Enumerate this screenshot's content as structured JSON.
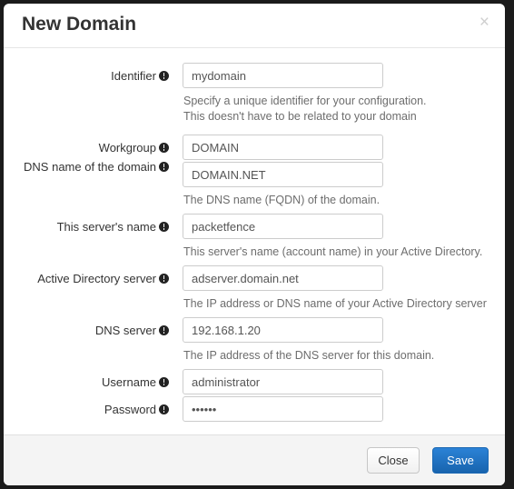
{
  "modal": {
    "title": "New Domain",
    "close_icon": "×",
    "footer": {
      "close_label": "Close",
      "save_label": "Save"
    },
    "accent_color": "#2b82d6",
    "fields": [
      {
        "label": "Identifier",
        "value": "mydomain",
        "help": [
          "Specify a unique identifier for your configuration.",
          "This doesn't have to be related to your domain"
        ]
      },
      {
        "label": "Workgroup",
        "value": "DOMAIN",
        "help": []
      },
      {
        "label": "DNS name of the domain",
        "value": "DOMAIN.NET",
        "help": [
          "The DNS name (FQDN) of the domain."
        ]
      },
      {
        "label": "This server's name",
        "value": "packetfence",
        "help": [
          "This server's name (account name) in your Active Directory."
        ]
      },
      {
        "label": "Active Directory server",
        "value": "adserver.domain.net",
        "help": [
          "The IP address or DNS name of your Active Directory server"
        ]
      },
      {
        "label": "DNS server",
        "value": "192.168.1.20",
        "help": [
          "The IP address of the DNS server for this domain."
        ]
      },
      {
        "label": "Username",
        "value": "administrator",
        "help": []
      },
      {
        "label": "Password",
        "value": "••••••",
        "help": []
      }
    ]
  }
}
